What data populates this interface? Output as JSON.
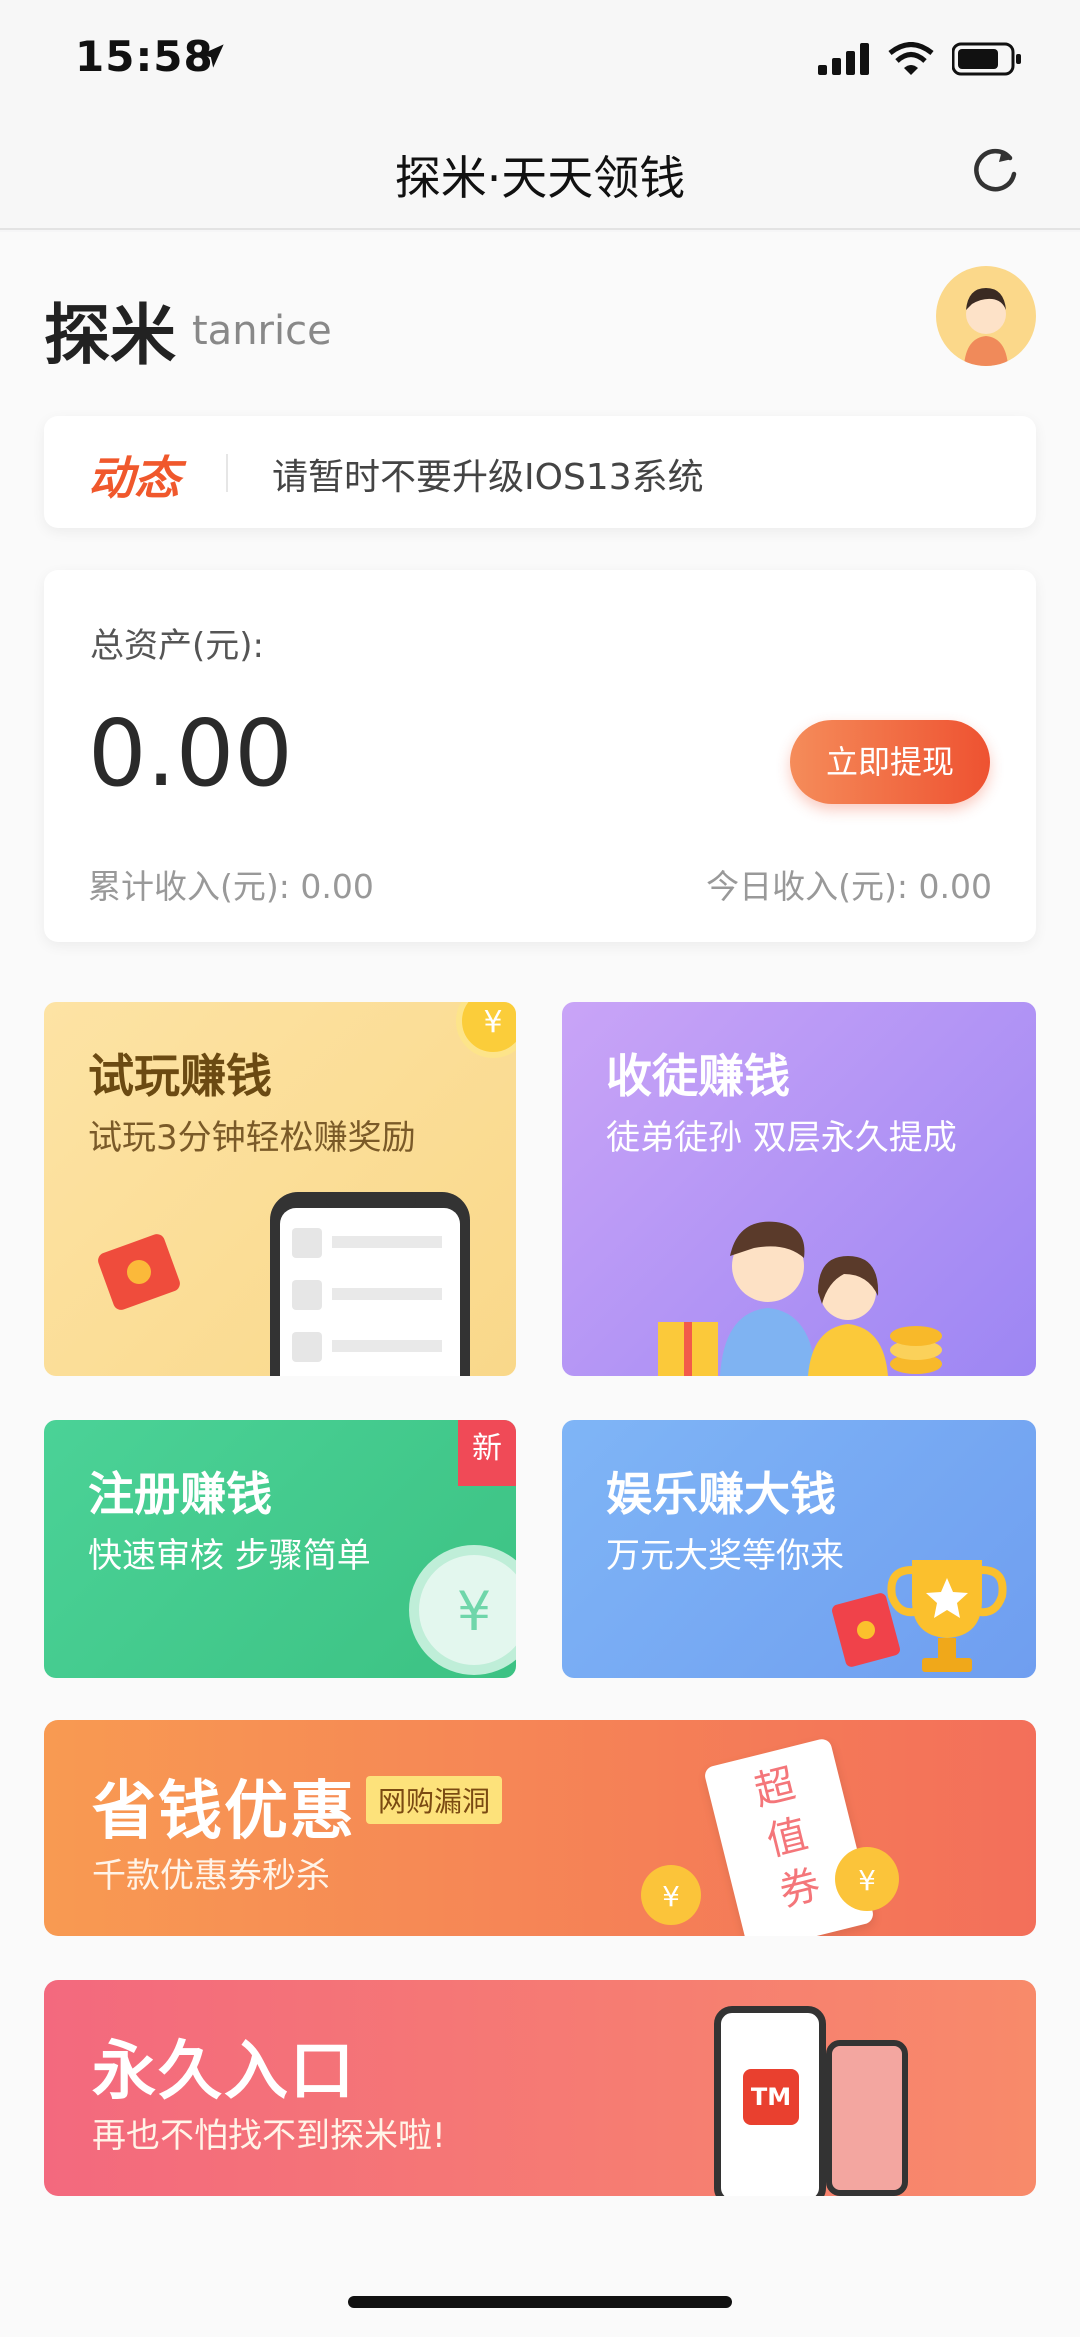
{
  "status": {
    "time": "15:58"
  },
  "nav": {
    "title": "探米·天天领钱"
  },
  "brand": {
    "name": "探米",
    "sub": "tanrice"
  },
  "notice": {
    "tag": "动态",
    "text": "请暂时不要升级IOS13系统"
  },
  "asset": {
    "label": "总资产(元):",
    "value": "0.00",
    "withdraw_label": "立即提现",
    "total_income": "累计收入(元):  0.00",
    "today_income": "今日收入(元):  0.00"
  },
  "cards": [
    {
      "title": "试玩赚钱",
      "subtitle": "试玩3分钟轻松赚奖励"
    },
    {
      "title": "收徒赚钱",
      "subtitle": "徒弟徒孙 双层永久提成"
    },
    {
      "title": "注册赚钱",
      "subtitle": "快速审核 步骤简单",
      "badge": "新"
    },
    {
      "title": "娱乐赚大钱",
      "subtitle": "万元大奖等你来"
    }
  ],
  "banners": [
    {
      "title": "省钱优惠",
      "tag": "网购漏洞",
      "subtitle": "千款优惠券秒杀",
      "coupon": [
        "超",
        "值",
        "券"
      ]
    },
    {
      "title": "永久入口",
      "subtitle": "再也不怕找不到探米啦!",
      "icon_text": "TM"
    }
  ],
  "colors": {
    "accent": "#ee5231",
    "green": "#3cc283",
    "blue": "#6f9ef0",
    "purple": "#9d86f3"
  }
}
